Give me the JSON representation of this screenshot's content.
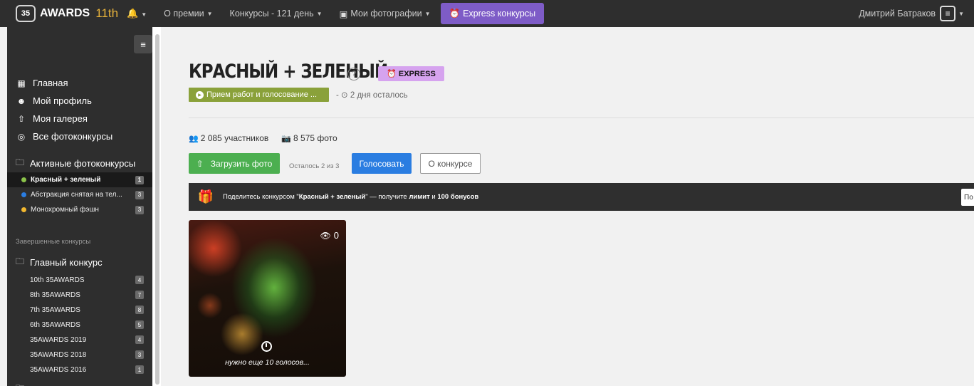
{
  "topbar": {
    "logo_badge": "35",
    "logo_text": "AWARDS",
    "edition": "11th",
    "nav": [
      {
        "label": "О премии"
      },
      {
        "label": "Конкурсы - 121 день"
      },
      {
        "label": "Мои фотографии"
      }
    ],
    "express_label": "Express конкурсы",
    "user_name": "Дмитрий Батраков"
  },
  "sidebar": {
    "main_items": [
      "Главная",
      "Мой профиль",
      "Моя галерея",
      "Все фотоконкурсы"
    ],
    "active_section": "Активные фотоконкурсы",
    "active_contests": [
      {
        "label": "Красный + зеленый",
        "count": "1",
        "dot": "#8bc34a"
      },
      {
        "label": "Абстракция снятая на тел...",
        "count": "3",
        "dot": "#2a7de1"
      },
      {
        "label": "Монохромный фэшн",
        "count": "3",
        "dot": "#f2b82f"
      }
    ],
    "finished_label": "Завершенные конкурсы",
    "main_section": "Главный конкурс",
    "main_contests": [
      {
        "label": "10th 35AWARDS",
        "count": "4"
      },
      {
        "label": "8th 35AWARDS",
        "count": "7"
      },
      {
        "label": "7th 35AWARDS",
        "count": "8"
      },
      {
        "label": "6th 35AWARDS",
        "count": "5"
      },
      {
        "label": "35AWARDS 2019",
        "count": "4"
      },
      {
        "label": "35AWARDS 2018",
        "count": "3"
      },
      {
        "label": "35AWARDS 2016",
        "count": "1"
      }
    ]
  },
  "contest": {
    "title": "КРАСНЫЙ + ЗЕЛЕНЫЙ",
    "badge": "EXPRESS",
    "status": "Прием работ и голосование ...",
    "remaining": "- ⊙ 2 дня осталось",
    "participants": "2 085 участников",
    "photos": "8 575 фото",
    "upload_label": "Загрузить фото",
    "uploads_left": "Осталось 2 из 3",
    "vote_label": "Голосовать",
    "about_label": "О конкурсе",
    "share": {
      "prefix": "Поделитесь конкурсом \"",
      "contest": "Красный + зеленый",
      "middle": "\" — получите ",
      "limit": "лимит",
      "and": " и ",
      "bonus": "100 бонусов",
      "button": "По"
    }
  },
  "photo": {
    "views": "0",
    "note": "нужно еще 10 голосов..."
  }
}
